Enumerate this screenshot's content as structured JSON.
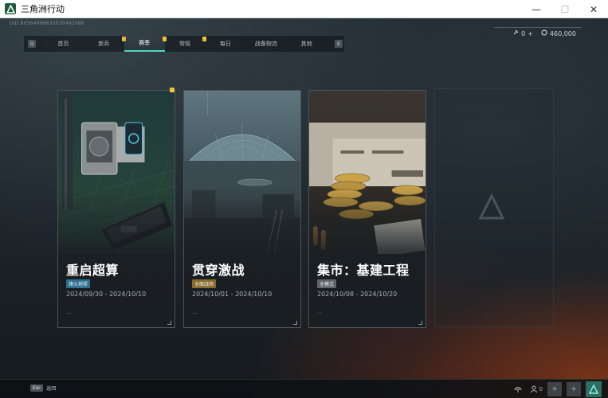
{
  "window": {
    "title": "三角洲行动",
    "min_label": "—",
    "max_label": "☐",
    "close_label": "✕"
  },
  "uid": "UID:80564986630930493086",
  "top_right": {
    "count_value": "0",
    "plus_label": "+",
    "currency_value": "460,000"
  },
  "tabs": {
    "left_key": "Q",
    "right_key": "E",
    "items": [
      {
        "label": "首页",
        "active": false,
        "badge": false
      },
      {
        "label": "新兵",
        "active": false,
        "badge": true
      },
      {
        "label": "赛季",
        "active": true,
        "badge": true
      },
      {
        "label": "常规",
        "active": false,
        "badge": true
      },
      {
        "label": "每日",
        "active": false,
        "badge": false
      },
      {
        "label": "战备物流",
        "active": false,
        "badge": false
      },
      {
        "label": "其他",
        "active": false,
        "badge": false
      }
    ]
  },
  "cards": [
    {
      "title": "重启超算",
      "tag": "烽火地带",
      "tag_color": "#2f6f8f",
      "date": "2024/09/30 - 2024/10/10",
      "more": "..."
    },
    {
      "title": "贯穿激战",
      "tag": "全面战场",
      "tag_color": "#8a6a2a",
      "date": "2024/10/01 - 2024/10/10",
      "more": "..."
    },
    {
      "title": "集市：基建工程",
      "tag": "全模式",
      "tag_color": "#5e6469",
      "date": "2024/10/08 - 2024/10/20",
      "more": "..."
    }
  ],
  "bottom": {
    "esc_key": "Esc",
    "esc_label": "返回",
    "friends_count": "0"
  },
  "colors": {
    "accent": "#4fd3c4",
    "badge": "#f1c232"
  }
}
